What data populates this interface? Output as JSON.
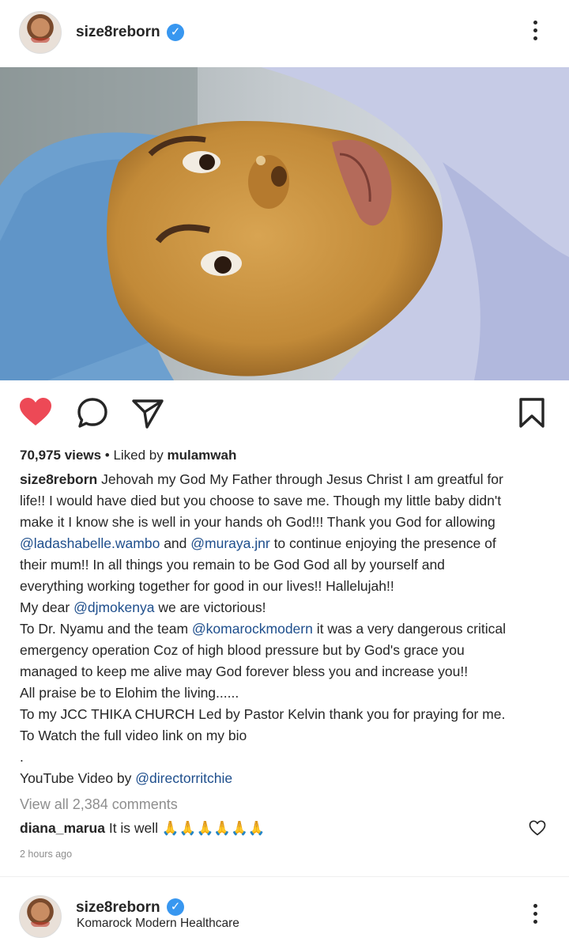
{
  "post": {
    "username": "size8reborn",
    "views": "70,975 views",
    "liked_prefix": "• Liked by ",
    "liked_by": "mulamwah",
    "caption_user": "size8reborn",
    "caption": {
      "l1": " Jehovah my God My Father through Jesus Christ I am greatful for",
      "l2": "life!! I would have died but you choose to save me. Though my little baby didn't",
      "l3": "make it I know she is well in your hands oh God!!! Thank you God for allowing",
      "l4_m1": "@ladashabelle.wambo",
      "l4_t1": "  and ",
      "l4_m2": "@muraya.jnr",
      "l4_t2": " to continue enjoying the presence of",
      "l5": "their mum!! In all things you remain to be God God all by yourself and",
      "l6": "everything working together for good in our lives!! Hallelujah!!",
      "l7_t1": "My dear ",
      "l7_m": "@djmokenya",
      "l7_t2": " we are victorious!",
      "l8_t1": "To Dr. Nyamu and the team ",
      "l8_m": "@komarockmodern",
      "l8_t2": " it was a very dangerous critical",
      "l9": "emergency operation Coz of high blood pressure but by God's grace you",
      "l10": "managed to keep me alive may God forever bless you and increase you!!",
      "l11": "All praise be to Elohim the living......",
      "l12": "To my JCC THIKA CHURCH Led by Pastor Kelvin thank you for praying for me.",
      "l13": "To Watch the full video link on my bio",
      "l14": ".",
      "l15_t": "YouTube Video by ",
      "l15_m": "@directorritchie"
    },
    "view_all": "View all 2,384 comments",
    "comment_user": "diana_marua",
    "comment_text": " It is well 🙏🙏🙏🙏🙏🙏",
    "time": "2 hours ago"
  },
  "next_post": {
    "username": "size8reborn",
    "location": "Komarock Modern Healthcare"
  },
  "colors": {
    "like": "#ed4956",
    "verified": "#3897f0",
    "mention": "#1e4e8c"
  },
  "icons": {
    "like": "heart-icon",
    "comment": "comment-icon",
    "share": "share-icon",
    "save": "bookmark-icon",
    "more": "more-options-icon",
    "verified": "verified-badge-icon"
  }
}
